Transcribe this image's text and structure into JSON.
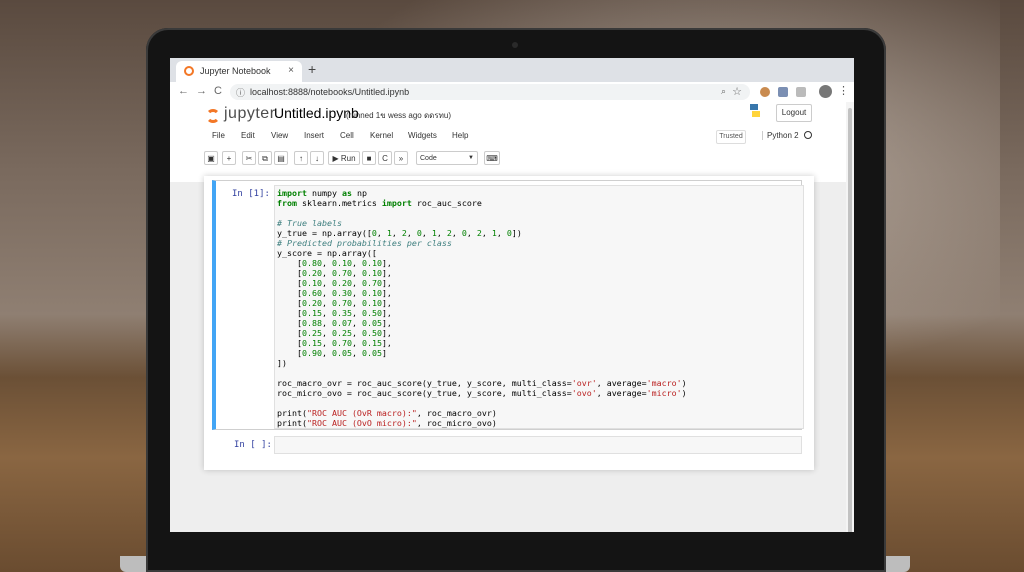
{
  "browser": {
    "tab_title": "Jupyter Notebook",
    "tab_close": "×",
    "new_tab": "+",
    "url": "localhost:8888/notebooks/Untitled.ipynb",
    "nav_back": "←",
    "nav_forward": "→",
    "nav_reload": "C",
    "zoom_icon": "🔍",
    "star": "☆",
    "menu": "⋮"
  },
  "jupyter": {
    "logo_text": "jupyter",
    "notebook_name": "Untitled.ipynb",
    "checkpoint": "(runned 1ข wess ago ดดรทu)",
    "logout_label": "Logout",
    "menu_items": [
      "File",
      "Edit",
      "View",
      "Insert",
      "Cell",
      "Kernel",
      "Widgets",
      "Help"
    ],
    "trusted_label": "Trusted",
    "kernel_name": "Python 2",
    "toolbar": {
      "save_icon": "💾",
      "add_icon": "+",
      "cut_icon": "✂",
      "copy_icon": "⧉",
      "paste_icon": "📋",
      "up_icon": "↑",
      "down_icon": "↓",
      "run_label": "▶ Run",
      "stop_icon": "■",
      "restart_icon": "C",
      "restart_run_icon": "⏩",
      "cell_type": "Code",
      "keyboard_icon": "⌨"
    }
  },
  "cells": [
    {
      "prompt": "In [1]:",
      "source_lines": [
        "import numpy as np",
        "from sklearn.metrics import roc_auc_score",
        "",
        "# True labels",
        "y_true = np.array([0, 1, 2, 0, 1, 2, 0, 2, 1, 0])",
        "# Predicted probabilities per class",
        "y_score = np.array([",
        "    [0.80, 0.10, 0.10],",
        "    [0.20, 0.70, 0.10],",
        "    [0.10, 0.20, 0.70],",
        "    [0.60, 0.30, 0.10],",
        "    [0.20, 0.70, 0.10],",
        "    [0.15, 0.35, 0.50],",
        "    [0.88, 0.07, 0.05],",
        "    [0.25, 0.25, 0.50],",
        "    [0.15, 0.70, 0.15],",
        "    [0.90, 0.05, 0.05]",
        "])",
        "",
        "roc_macro_ovr = roc_auc_score(y_true, y_score, multi_class='ovr', average='macro')",
        "roc_micro_ovo = roc_auc_score(y_true, y_score, multi_class='ovo', average='micro')",
        "",
        "print(\"ROC AUC (OvR macro):\", roc_macro_ovr)",
        "print(\"ROC AUC (OvO micro):\", roc_micro_ovo)"
      ]
    },
    {
      "prompt": "In [ ]:",
      "source_lines": []
    }
  ]
}
